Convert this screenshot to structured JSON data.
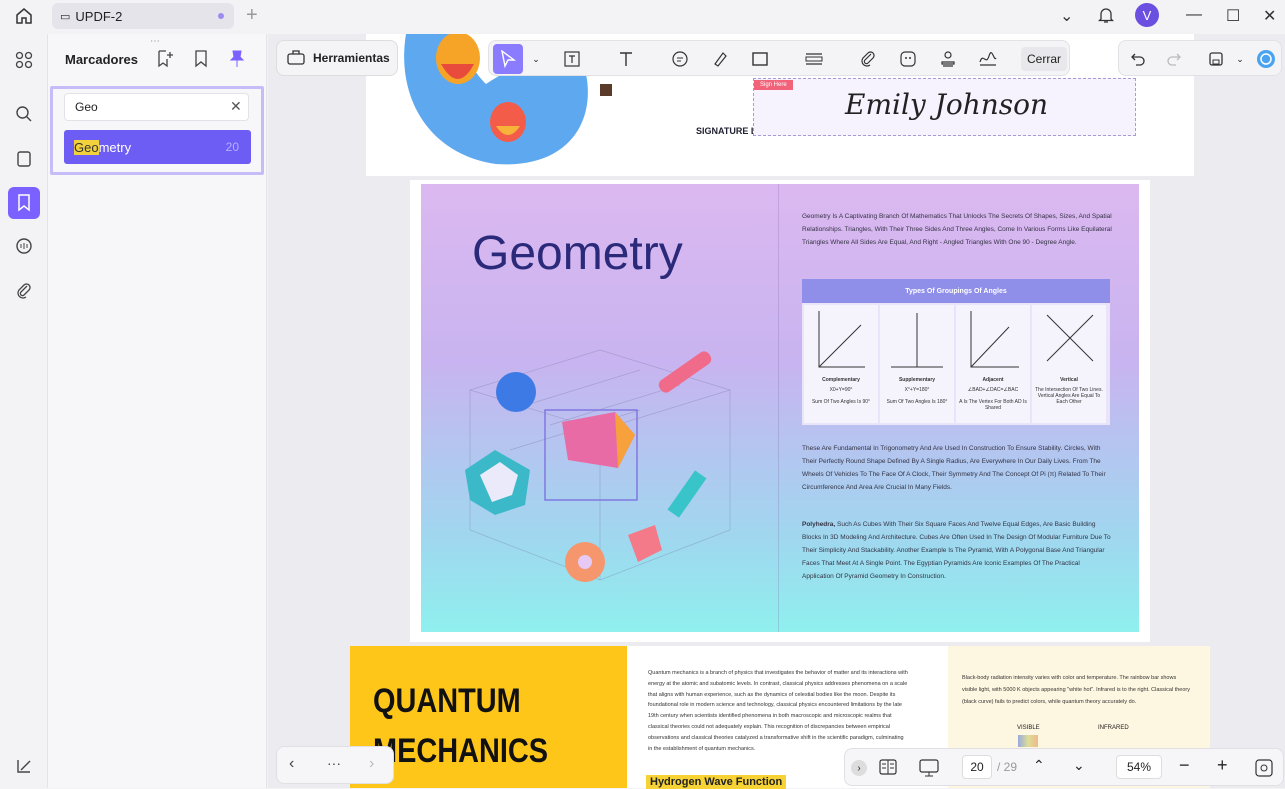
{
  "window": {
    "tab_title": "UPDF-2",
    "avatar_letter": "V"
  },
  "panel": {
    "title": "Marcadores",
    "search_value": "Geo",
    "result_match": "Geo",
    "result_rest": "metry",
    "result_page": "20"
  },
  "toolbar": {
    "tools_label": "Herramientas",
    "close_label": "Cerrar"
  },
  "page_top": {
    "sign_here": "Sign Here",
    "signature_name": "Emily Johnson",
    "signature_label": "SIGNATURE L"
  },
  "geometry_page": {
    "title": "Geometry",
    "intro": "Geometry Is A Captivating Branch Of Mathematics That Unlocks The Secrets Of Shapes, Sizes, And Spatial Relationships. Triangles, With Their Three Sides And Three Angles, Come In Various Forms Like Equilateral Triangles Where All Sides Are Equal, And Right - Angled Triangles With One 90 - Degree Angle.",
    "angle_table_title": "Types Of Groupings Of Angles",
    "angle_cells": [
      {
        "name": "Complementary",
        "formula": "X0+Y=90°",
        "desc": "Sum Of Two Angles Is 90°"
      },
      {
        "name": "Supplementary",
        "formula": "X°+Y=180°",
        "desc": "Sum Of Two Angles Is 180°"
      },
      {
        "name": "Adjacent",
        "formula": "∠BAD+∠DAC=∠BAC",
        "desc": "A Is The Vertex For Both AD Is Shared"
      },
      {
        "name": "Vertical",
        "formula": "",
        "desc": "The Intersection Of Two Lines. Vertical Angles Are Equal To Each Other"
      }
    ],
    "para2": "These Are Fundamental In Trigonometry And Are Used In Construction To Ensure Stability. Circles, With Their Perfectly Round Shape Defined By A Single Radius, Are Everywhere In Our Daily Lives. From The Wheels Of Vehicles To The Face Of A Clock, Their Symmetry And The Concept Of Pi (π) Related To Their Circumference And Area Are Crucial In Many Fields.",
    "para3_bold": "Polyhedra,",
    "para3": " Such As Cubes With Their Six Square Faces And Twelve Equal Edges, Are Basic Building Blocks In 3D Modeling And Architecture. Cubes Are Often Used In The Design Of Modular Furniture Due To Their Simplicity And Stackability. Another Example Is The Pyramid, With A Polygonal Base And Triangular Faces That Meet At A Single Point. The Egyptian Pyramids Are Iconic Examples Of The Practical Application Of Pyramid Geometry In Construction."
  },
  "quantum_page": {
    "title_line1": "QUANTUM",
    "title_line2": "MECHANICS",
    "text": "Quantum mechanics is a branch of physics that investigates the behavior of matter and its interactions with energy at the atomic and subatomic levels. In contrast, classical physics addresses phenomena on a scale that aligns with human experience, such as the dynamics of celestial bodies like the moon. Despite its foundational role in modern science and technology, classical physics encountered limitations by the late 19th century when scientists identified phenomena in both macroscopic and microscopic realms that classical theories could not adequately explain. This recognition of discrepancies between empirical observations and classical theories catalyzed a transformative shift in the scientific paradigm, culminating in the establishment of quantum mechanics.",
    "blackbody": "Black-body radiation intensity varies with color and temperature. The rainbow bar shows visible light, with 5000 K objects appearing \"white hot\". Infrared is to the right. Classical theory (black curve) fails to predict colors, while quantum theory accurately do.",
    "visible": "VISIBLE",
    "infrared": "INFRARED",
    "hydrogen": "Hydrogen Wave Function"
  },
  "bottom": {
    "current_page": "20",
    "total_pages": "/ 29",
    "zoom": "54%",
    "more": "···"
  }
}
